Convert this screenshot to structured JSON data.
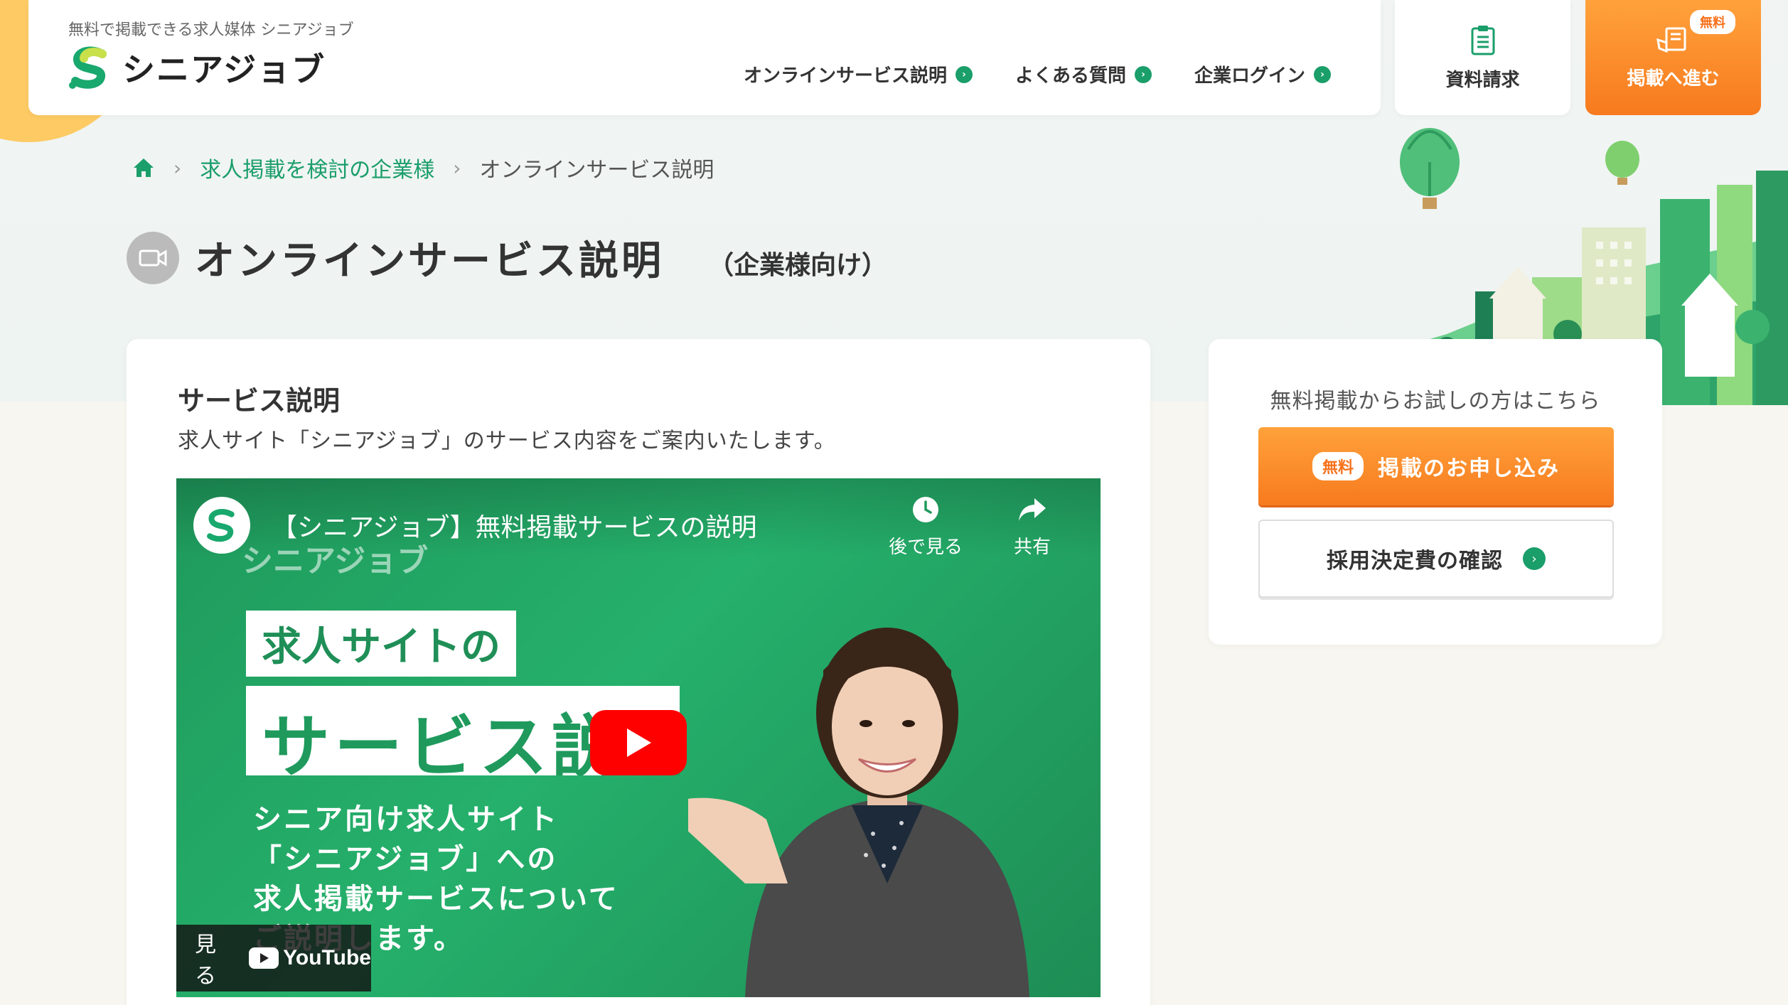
{
  "header": {
    "tagline": "無料で掲載できる求人媒体 シニアジョブ",
    "logo_text": "シニアジョブ",
    "nav": [
      {
        "label": "オンラインサービス説明"
      },
      {
        "label": "よくある質問"
      },
      {
        "label": "企業ログイン"
      }
    ],
    "doc_request_label": "資料請求",
    "post_label": "掲載へ進む",
    "post_badge": "無料"
  },
  "breadcrumb": {
    "items": [
      "求人掲載を検討の企業様",
      "オンラインサービス説明"
    ]
  },
  "page": {
    "title": "オンラインサービス説明",
    "subtitle": "（企業様向け）"
  },
  "main": {
    "section_title": "サービス説明",
    "section_desc": "求人サイト「シニアジョブ」のサービス内容をご案内いたします。",
    "video": {
      "title": "【シニアジョブ】無料掲載サービスの説明",
      "watch_later": "後で見る",
      "share": "共有",
      "watermark": "シニアジョブ",
      "headline1": "求人サイトの",
      "headline2": "サービス説明",
      "lines": [
        "シニア向け求人サイト",
        "「シニアジョブ」への",
        "求人掲載サービスについて",
        "ご説明します。"
      ],
      "watch_on": "見る",
      "platform": "YouTube"
    }
  },
  "side": {
    "lead": "無料掲載からお試しの方はこちら",
    "apply_badge": "無料",
    "apply_label": "掲載のお申し込み",
    "fee_label": "採用決定費の確認"
  },
  "colors": {
    "brand_green": "#1a9e6a",
    "accent_orange": "#f77a1e",
    "youtube_red": "#ff0000"
  }
}
